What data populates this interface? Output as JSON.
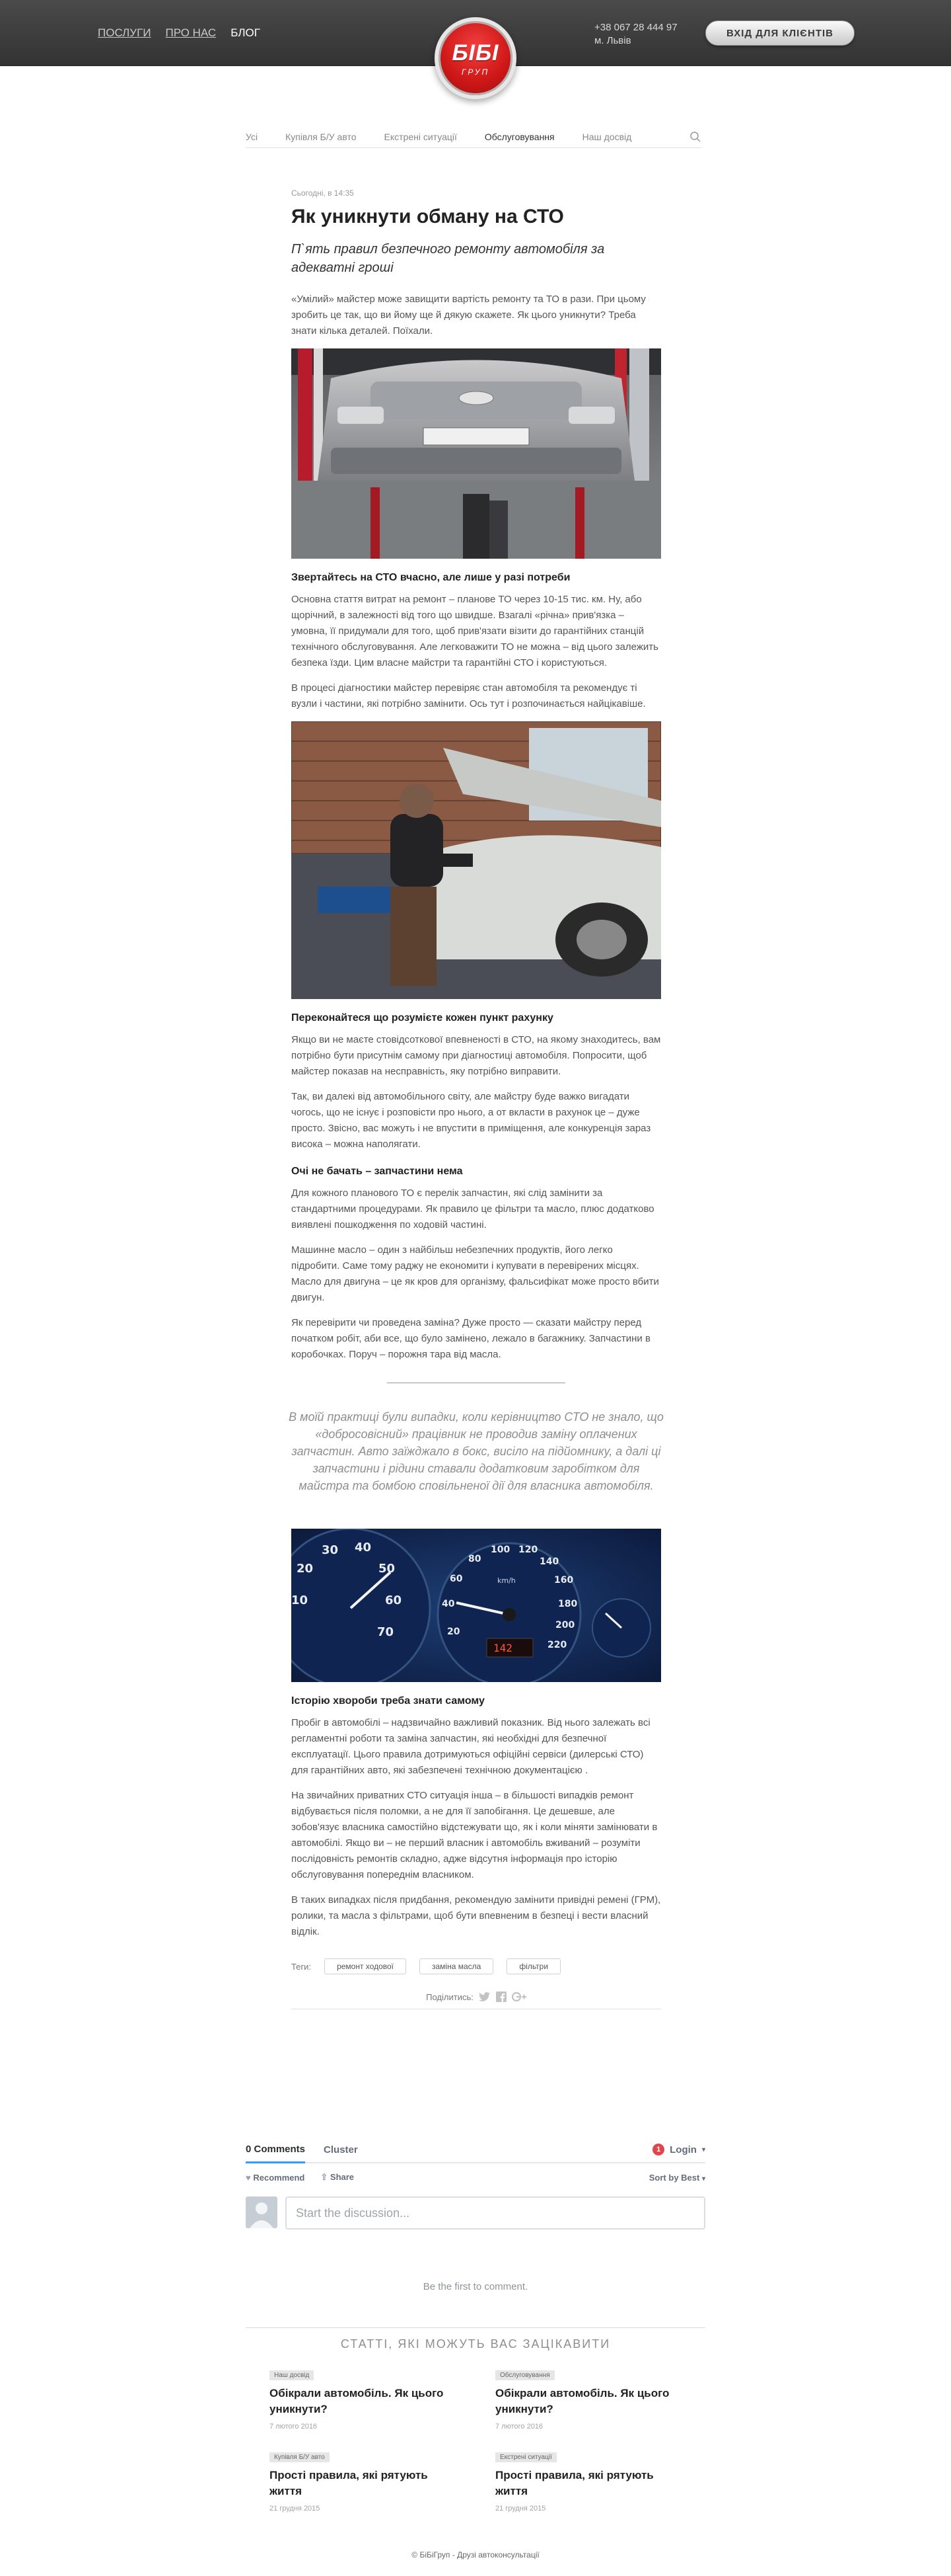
{
  "header": {
    "nav": [
      {
        "label": "ПОСЛУГИ",
        "active": false
      },
      {
        "label": "ПРО НАС",
        "active": false
      },
      {
        "label": "БЛОГ",
        "active": true
      }
    ],
    "logo_text": "БІБІ",
    "logo_sub": "ГРУП",
    "phone": "+38 067 28 444 97",
    "city": "м. Львів",
    "client_button": "ВХІД ДЛЯ КЛІЄНТІВ"
  },
  "categories": [
    {
      "label": "Усі",
      "active": false
    },
    {
      "label": "Купівля Б/У авто",
      "active": false
    },
    {
      "label": "Екстрені ситуації",
      "active": false
    },
    {
      "label": "Обслуговування",
      "active": true
    },
    {
      "label": "Наш досвід",
      "active": false
    }
  ],
  "article": {
    "date": "Сьогодні, в 14:35",
    "title": "Як уникнути обману на СТО",
    "subtitle": "П`ять правил безпечного ремонту автомобіля за адекватні гроші",
    "intro": "«Умілий» майстер може завищити вартість ремонту та ТО в рази. При цьому зробить це так, що ви йому ще й дякую скажете. Як цього уникнути? Треба знати кілька деталей. Поїхали.",
    "s1_heading": "Звертайтесь на СТО вчасно, але лише у разі потреби",
    "s1_p1": "Основна стаття витрат на ремонт – планове ТО через 10-15 тис. км. Ну, або щорічний, в залежності від того що швидше. Взагалі «річна» прив'язка – умовна, її придумали для того, щоб прив'язати візити до гарантійних станцій технічного обслуговування. Але легковажити ТО не можна – від цього залежить безпека їзди. Цим власне майстри та гарантійні СТО і користуються.",
    "s1_p2": "В процесі діагностики майстер перевіряє стан автомобіля та рекомендує ті вузли і частини, які потрібно замінити. Ось тут і розпочинається найцікавіше.",
    "s2_heading": "Переконайтеся що розумієте кожен пункт рахунку",
    "s2_p1": "Якщо ви не маєте стовідсоткової впевненості в СТО, на якому знаходитесь,  вам потрібно бути присутнім самому при діагностиці автомобіля.  Попросити, щоб майстер показав на несправність, яку потрібно виправити.",
    "s2_p2": "Так, ви далекі від автомобільного світу, але майстру буде важко вигадати чогось, що не існує і розповісти про нього, а от вкласти в рахунок це – дуже просто. Звісно, вас можуть і не впустити в  приміщення, але конкуренція зараз висока – можна наполягати.",
    "s3_heading": "Очі не бачать – запчастини нема",
    "s3_p1": "Для кожного планового ТО є перелік запчастин, які слід замінити за стандартними процедурами. Як правило це фільтри та масло, плюс додатково виявлені пошкодження по ходовій частині.",
    "s3_p2": "Машинне масло – один з найбільш небезпечних продуктів, його легко підробити. Саме тому раджу не економити і купувати в перевірених місцях. Масло для двигуна – це як кров для організму, фальсифікат може просто вбити двигун.",
    "s3_p3": "Як перевірити чи проведена заміна? Дуже просто — сказати майстру перед початком робіт, аби все, що було замінено, лежало в багажнику. Запчастини в коробочках. Поруч – порожня тара від масла.",
    "quote": "В моїй практиці були випадки, коли керівництво СТО не знало, що «добросовісний» працівник не проводив заміну оплачених запчастин. Авто заїжджало в бокс, висіло на підйомнику, а далі ці запчастини і рідини ставали додатковим заробітком для майстра та бомбою сповільненої дії для власника автомобіля.",
    "s4_heading": "Історію хвороби треба знати самому",
    "s4_p1": "Пробіг в автомобілі – надзвичайно важливий показник. Від нього залежать всі регламентні роботи та заміна запчастин, які необхідні для безпечної експлуатації. Цього правила дотримуються офіційні сервіси (дилерські СТО) для гарантійних авто, які забезпечені технічною документацією .",
    "s4_p2": "На звичайних приватних СТО ситуація інша – в більшості випадків ремонт відбувається після поломки, а не для її запобігання. Це дешевше, але зобов'язує власника самостійно відстежувати що, як і коли міняти замінювати в автомобілі. Якщо ви – не перший власник і автомобіль вживаний – розуміти послідовність ремонтів складно, адже відсутня інформація про історію обслуговування попереднім власником.",
    "s4_p3": "В таких випадках після придбання, рекомендую замінити привідні ремені (ГРМ), ролики, та масла з фільтрами, щоб бути впевненим в безпеці і вести власний відлік.",
    "tags_label": "Теги:",
    "tags": [
      "ремонт ходової",
      "заміна масла",
      "фільтри"
    ],
    "share_label": "Поділитись:"
  },
  "gauge": {
    "speed_ticks": [
      "20",
      "40",
      "60",
      "80",
      "100",
      "120",
      "140",
      "160",
      "180",
      "200",
      "220"
    ],
    "rpm_ticks": [
      "10",
      "20",
      "30",
      "40",
      "50",
      "60",
      "70"
    ],
    "unit": "km/h",
    "odometer": "142"
  },
  "comments": {
    "count_tab": "0 Comments",
    "cluster_tab": "Cluster",
    "login": "Login",
    "login_badge": "1",
    "recommend": "Recommend",
    "share": "Share",
    "sort": "Sort by Best",
    "placeholder": "Start the discussion...",
    "empty": "Be the first to comment."
  },
  "related": {
    "title": "СТАТТІ, ЯКІ МОЖУТЬ ВАС ЗАЦІКАВИТИ",
    "items": [
      {
        "tag": "Наш досвід",
        "title": "Обікрали автомобіль. Як цього уникнути?",
        "date": "7 лютого 2016"
      },
      {
        "tag": "Обслуговування",
        "title": "Обікрали автомобіль. Як цього уникнути?",
        "date": "7 лютого 2016"
      },
      {
        "tag": "Купівля Б/У авто",
        "title": "Прості правила, які рятують життя",
        "date": "21 грудня 2015"
      },
      {
        "tag": "Екстрені ситуації",
        "title": "Прості правила, які рятують життя",
        "date": "21 грудня 2015"
      }
    ]
  },
  "footer": "© БіБіГруп - Друзі автоконсультації",
  "colors": {
    "header_bg": "#3d3d3d",
    "logo_red": "#d01818",
    "disqus_blue": "#2e9fff",
    "badge_red": "#e0474d"
  }
}
